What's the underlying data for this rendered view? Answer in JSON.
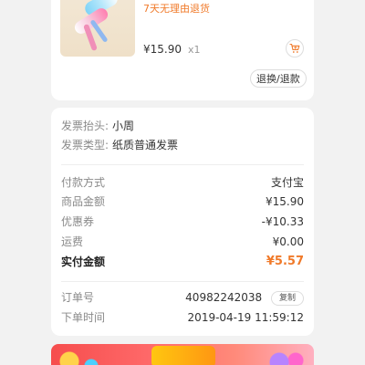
{
  "product": {
    "promise": "7天无理由退货",
    "price": "¥15.90",
    "qty": "x1",
    "return_button": "退换/退款"
  },
  "invoice": {
    "title_label": "发票抬头:",
    "title_value": "小周",
    "type_label": "发票类型:",
    "type_value": "纸质普通发票"
  },
  "payment": {
    "method_label": "付款方式",
    "method_value": "支付宝",
    "amount_label": "商品金额",
    "amount_value": "¥15.90",
    "coupon_label": "优惠券",
    "coupon_value": "-¥10.33",
    "shipping_label": "运费",
    "shipping_value": "¥0.00",
    "paid_label": "实付金额",
    "paid_value": "¥5.57"
  },
  "order": {
    "number_label": "订单号",
    "number_value": "40982242038",
    "copy_button": "复制",
    "time_label": "下单时间",
    "time_value": "2019-04-19 11:59:12"
  },
  "colors": {
    "accent": "#f07a2a",
    "page_background": "#f2f2f2"
  }
}
